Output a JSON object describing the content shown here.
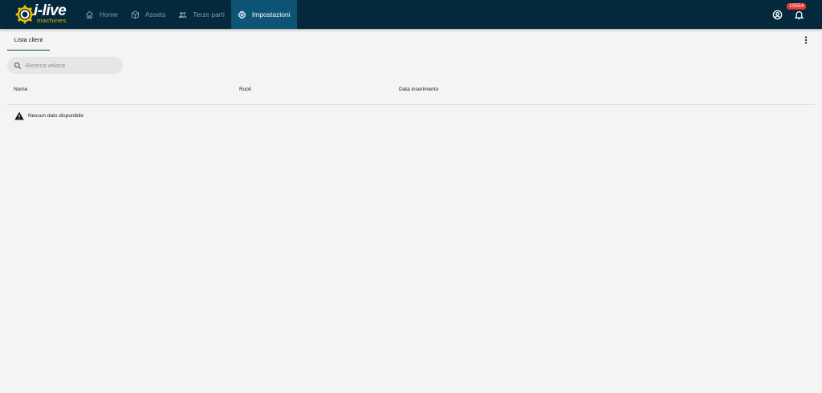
{
  "brand": {
    "name": "i-live",
    "tagline": "machines",
    "accent": "#f2c200"
  },
  "nav": {
    "items": [
      {
        "label": "Home",
        "icon": "home-icon"
      },
      {
        "label": "Assets",
        "icon": "cube-icon"
      },
      {
        "label": "Terze parti",
        "icon": "people-icon"
      },
      {
        "label": "Impostazioni",
        "icon": "gear-icon",
        "active": true
      }
    ]
  },
  "header": {
    "notification_count": "10554"
  },
  "tabs": [
    {
      "label": "Lista client",
      "active": true
    }
  ],
  "search": {
    "placeholder": "Ricerca veloce",
    "value": ""
  },
  "table": {
    "columns": [
      "Nome",
      "Ruoli",
      "Data inserimento"
    ],
    "rows": [],
    "empty_message": "Nessun dato disponibile"
  },
  "colors": {
    "topbar": "#04283c",
    "active_nav": "#0e5477",
    "badge": "#e53935",
    "background": "#f4f4f4"
  }
}
